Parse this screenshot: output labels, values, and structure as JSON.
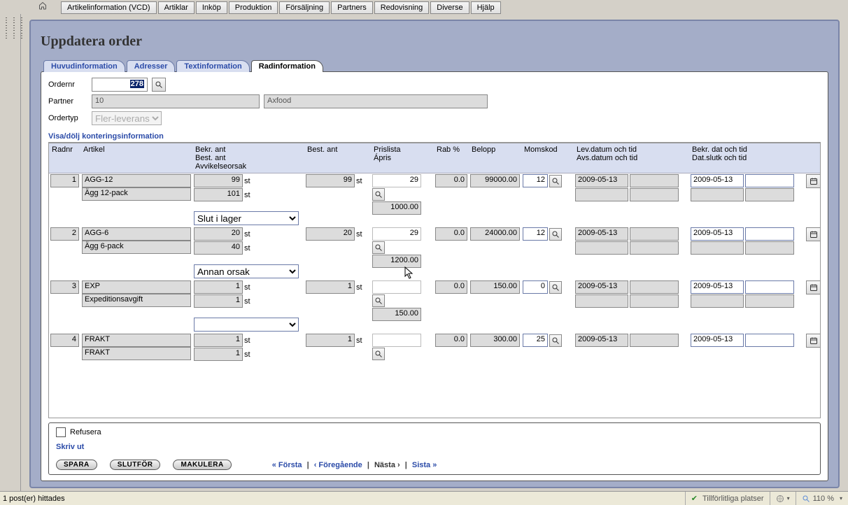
{
  "menu": {
    "items": [
      "Artikelinformation (VCD)",
      "Artiklar",
      "Inköp",
      "Produktion",
      "Försäljning",
      "Partners",
      "Redovisning",
      "Diverse",
      "Hjälp"
    ]
  },
  "page": {
    "title": "Uppdatera order"
  },
  "tabs": {
    "items": [
      "Huvudinformation",
      "Adresser",
      "Textinformation",
      "Radinformation"
    ],
    "activeIndex": 3
  },
  "header": {
    "ordernr_label": "Ordernr",
    "ordernr_value": "278",
    "partner_label": "Partner",
    "partner_code": "10",
    "partner_name": "Axfood",
    "ordertyp_label": "Ordertyp",
    "ordertyp_value": "Fler-leverans"
  },
  "section_toggle": "Visa/dölj konteringsinformation",
  "columns": {
    "radnr": "Radnr",
    "artikel": "Artikel",
    "bekr_best_avv": "Bekr. ant\nBest. ant\nAvvikelseorsak",
    "best_ant": "Best. ant",
    "prislista_apris": "Prislista\nÁpris",
    "rab": "Rab %",
    "belopp": "Belopp",
    "momskod": "Momskod",
    "lev_avs": "Lev.datum och tid\nAvs.datum och tid",
    "bekr_slutk": "Bekr. dat och tid\nDat.slutk och tid"
  },
  "unit": "st",
  "rows": [
    {
      "radnr": "1",
      "artikel": "AGG-12",
      "artikel_desc": "Ägg 12-pack",
      "bekr_ant": "99",
      "best_ant_sub": "101",
      "avvikelseorsak": "Slut i lager",
      "best_ant": "99",
      "prislista": "29",
      "apris": "1000.00",
      "rab": "0.0",
      "belopp": "99000.00",
      "momskod": "12",
      "lev_datum": "2009-05-13",
      "bekr_datum": "2009-05-13"
    },
    {
      "radnr": "2",
      "artikel": "AGG-6",
      "artikel_desc": "Ägg 6-pack",
      "bekr_ant": "20",
      "best_ant_sub": "40",
      "avvikelseorsak": "Annan orsak",
      "best_ant": "20",
      "prislista": "29",
      "apris": "1200.00",
      "rab": "0.0",
      "belopp": "24000.00",
      "momskod": "12",
      "lev_datum": "2009-05-13",
      "bekr_datum": "2009-05-13"
    },
    {
      "radnr": "3",
      "artikel": "EXP",
      "artikel_desc": "Expeditionsavgift",
      "bekr_ant": "1",
      "best_ant_sub": "1",
      "avvikelseorsak": "",
      "best_ant": "1",
      "prislista": "",
      "apris": "150.00",
      "rab": "0.0",
      "belopp": "150.00",
      "momskod": "0",
      "lev_datum": "2009-05-13",
      "bekr_datum": "2009-05-13"
    },
    {
      "radnr": "4",
      "artikel": "FRAKT",
      "artikel_desc": "FRAKT",
      "bekr_ant": "1",
      "best_ant_sub": "1",
      "avvikelseorsak": "",
      "best_ant": "1",
      "prislista": "",
      "apris": "",
      "rab": "0.0",
      "belopp": "300.00",
      "momskod": "25",
      "lev_datum": "2009-05-13",
      "bekr_datum": "2009-05-13"
    }
  ],
  "bottom": {
    "refusera": "Refusera",
    "skriv_ut": "Skriv ut",
    "spara": "SPARA",
    "slutfor": "SLUTFÖR",
    "makulera": "MAKULERA",
    "pager": {
      "first": "« Första",
      "prev": "‹ Föregående",
      "next": "Nästa ›",
      "last": "Sista »"
    }
  },
  "status": {
    "left": "1 post(er) hittades",
    "trusted": "Tillförlitliga platser",
    "zoom": "110 %"
  }
}
